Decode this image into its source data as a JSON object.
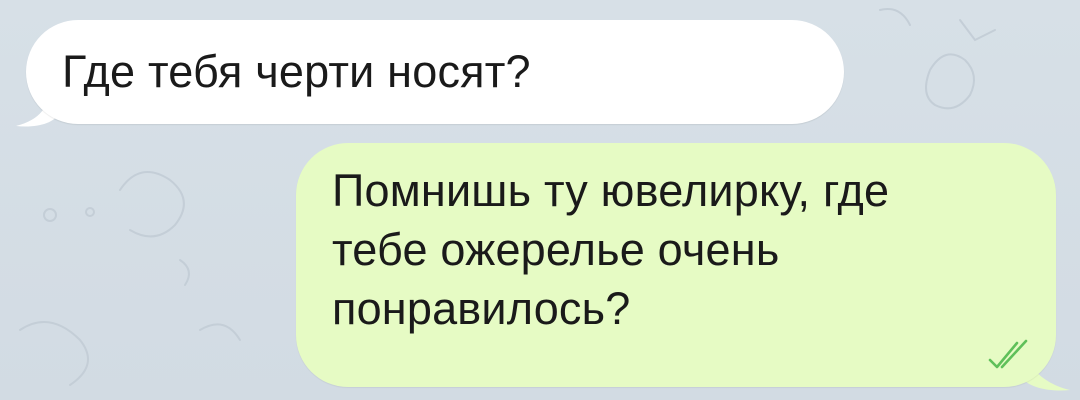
{
  "chat": {
    "messages": [
      {
        "direction": "incoming",
        "text": "Где тебя черти носят?"
      },
      {
        "direction": "outgoing",
        "text": "Помнишь ту ювелирку, где\nтебе ожерелье очень\nпонравилось?",
        "status_icon": "double-check-icon"
      }
    ]
  },
  "colors": {
    "background": "#d4dde5",
    "incoming_bubble": "#ffffff",
    "outgoing_bubble": "#e6fbc4",
    "read_check": "#5fc05a"
  }
}
